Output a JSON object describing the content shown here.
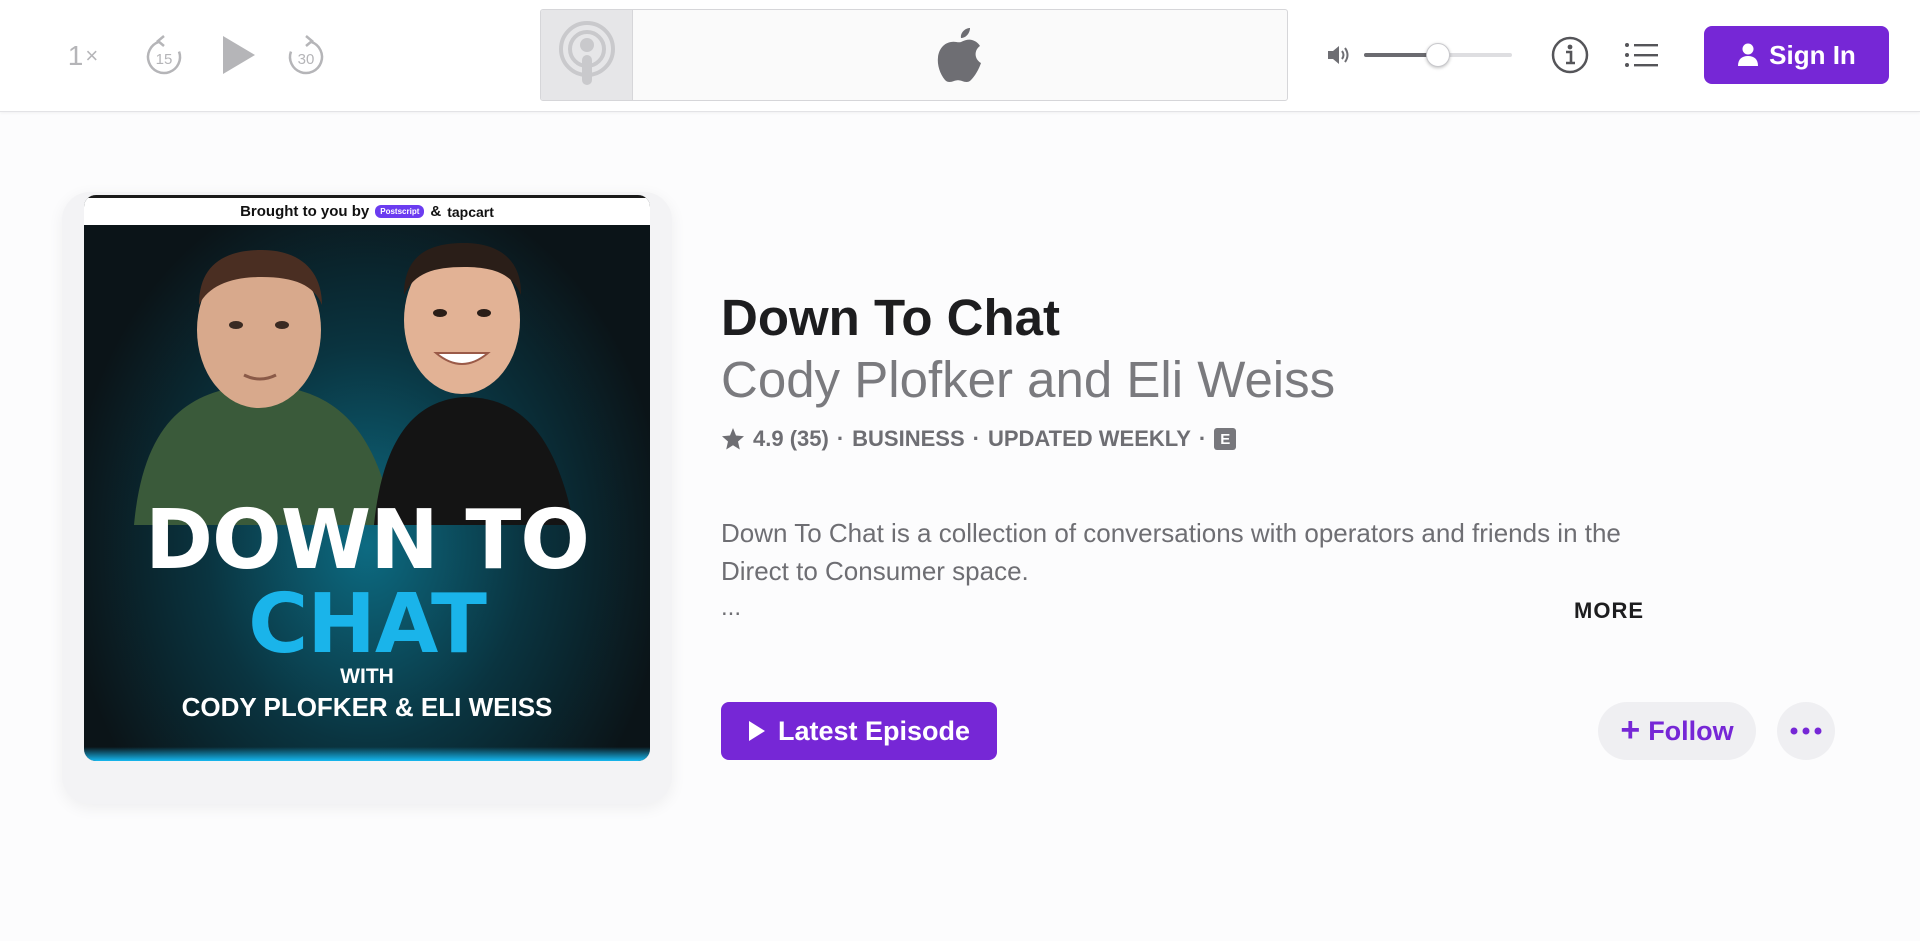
{
  "player": {
    "speed_value": "1",
    "speed_suffix": "×",
    "skip_back_seconds": "15",
    "skip_forward_seconds": "30",
    "volume_level": 0.5,
    "signin_label": "Sign In"
  },
  "artwork": {
    "banner_text": "Brought to you by",
    "banner_pill": "Postscript",
    "banner_amp": "&",
    "banner_brand": "tapcart",
    "title_line1": "DOWN TO",
    "title_line2": "CHAT",
    "with_text": "WITH",
    "hosts_text": "CODY PLOFKER & ELI WEISS"
  },
  "podcast": {
    "title": "Down To Chat",
    "author": "Cody Plofker and Eli Weiss",
    "rating": "4.9 (35)",
    "category": "BUSINESS",
    "frequency": "UPDATED WEEKLY",
    "sep": "·",
    "explicit": "E",
    "description": "Down To Chat is a collection of conversations with operators and friends in the Direct to Consumer space.",
    "ellipsis": "...",
    "more_label": "MORE"
  },
  "actions": {
    "latest_episode_label": "Latest Episode",
    "follow_label": "Follow",
    "follow_icon": "+"
  },
  "colors": {
    "accent": "#7627d6",
    "artwork_cyan": "#1ab4ea"
  }
}
